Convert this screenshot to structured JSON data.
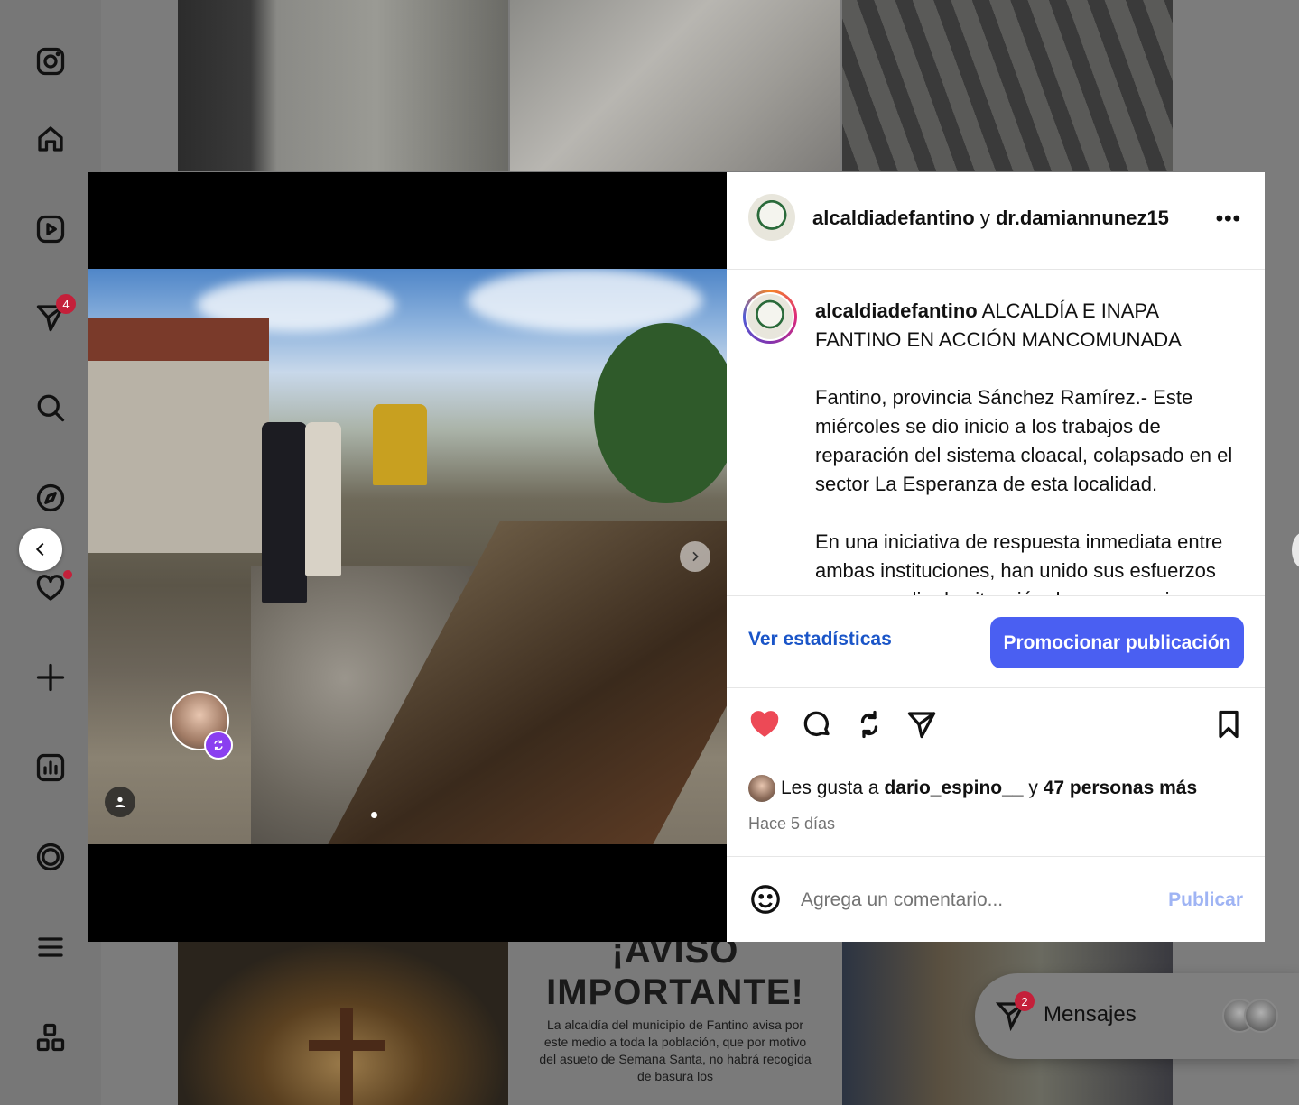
{
  "app": "Instagram",
  "sidebar": {
    "items": [
      {
        "name": "instagram-logo-icon"
      },
      {
        "name": "home-icon"
      },
      {
        "name": "reels-icon"
      },
      {
        "name": "direct-icon",
        "badge": "4"
      },
      {
        "name": "search-icon"
      },
      {
        "name": "explore-icon"
      },
      {
        "name": "notifications-icon"
      },
      {
        "name": "create-icon"
      },
      {
        "name": "dashboard-icon"
      },
      {
        "name": "profile-icon"
      },
      {
        "name": "menu-icon"
      },
      {
        "name": "more-apps-icon"
      }
    ]
  },
  "background_grid": {
    "aviso_title": "¡AVISO\nIMPORTANTE!",
    "aviso_body": "La alcaldía del municipio de Fantino avisa por este medio a toda la población, que por motivo del asueto de Semana Santa, no habrá recogida de basura los"
  },
  "post": {
    "header": {
      "author": "alcaldiadefantino",
      "conjunction": "y",
      "collaborator": "dr.damiannunez15",
      "more_label": "•••"
    },
    "caption": {
      "author": "alcaldiadefantino",
      "title": "ALCALDÍA E INAPA FANTINO EN ACCIÓN MANCOMUNADA",
      "paragraph1": "Fantino, provincia Sánchez Ramírez.- Este miércoles se dio inicio a los trabajos de reparación del sistema cloacal, colapsado en el sector La Esperanza de esta localidad.",
      "paragraph2": "En una iniciativa de respuesta inmediata entre ambas instituciones, han unido sus esfuerzos para remediar la situación de emergencia que afecta"
    },
    "promo": {
      "stats_label": "Ver estadísticas",
      "promote_label": "Promocionar publicación"
    },
    "actions": {
      "liked": true,
      "like_color": "#ed4956"
    },
    "likes": {
      "prefix": "Les gusta a",
      "user": "dario_espino__",
      "conjunction": "y",
      "others": "47 personas más"
    },
    "time_ago": "Hace 5 días",
    "comment": {
      "placeholder": "Agrega un comentario...",
      "publish_label": "Publicar"
    }
  },
  "messages": {
    "label": "Mensajes",
    "badge": "2"
  },
  "colors": {
    "accent": "#4a5ff2",
    "link": "#1a55c8",
    "badge": "#c4203a"
  }
}
